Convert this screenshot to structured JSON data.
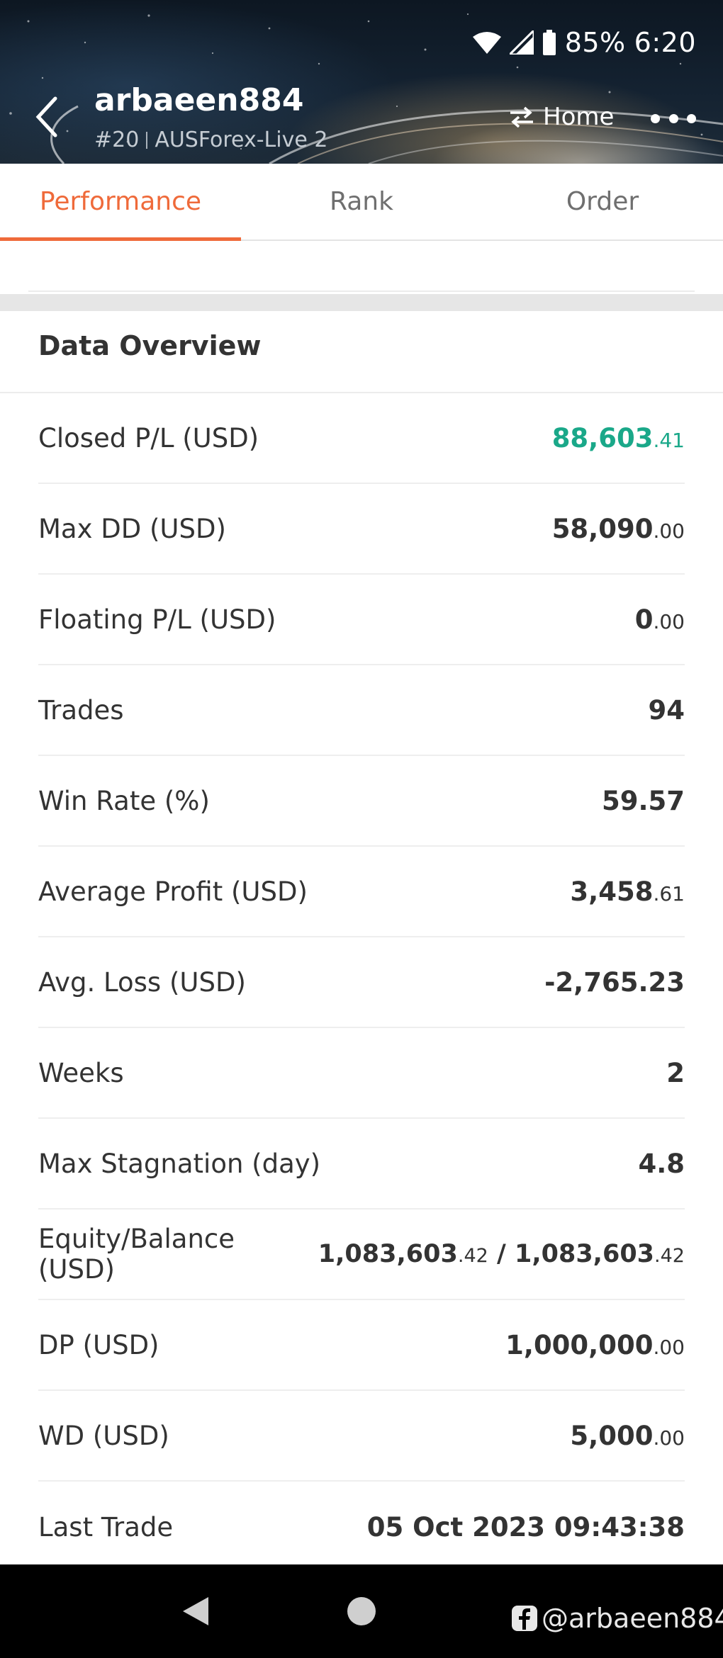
{
  "status": {
    "battery": "85%",
    "time": "6:20"
  },
  "header": {
    "account_name": "arbaeen884",
    "rank": "#20",
    "server": "AUSForex-Live 2",
    "home_label": "Home"
  },
  "tabs": [
    {
      "label": "Performance",
      "active": true
    },
    {
      "label": "Rank",
      "active": false
    },
    {
      "label": "Order",
      "active": false
    }
  ],
  "section": {
    "title": "Data Overview"
  },
  "rows": [
    {
      "label": "Closed P/L (USD)",
      "int": "88,603",
      "dec": ".41",
      "color": "#1aa889"
    },
    {
      "label": "Max DD (USD)",
      "int": "58,090",
      "dec": ".00"
    },
    {
      "label": "Floating P/L (USD)",
      "int": "0",
      "dec": ".00"
    },
    {
      "label": "Trades",
      "int": "94",
      "dec": ""
    },
    {
      "label": "Win Rate (%)",
      "int": "59.57",
      "dec": ""
    },
    {
      "label": "Average Profit (USD)",
      "int": "3,458",
      "dec": ".61"
    },
    {
      "label": "Avg. Loss (USD)",
      "int": "-2,765.23",
      "dec": ""
    },
    {
      "label": "Weeks",
      "int": "2",
      "dec": ""
    },
    {
      "label": "Max Stagnation (day)",
      "int": "4.8",
      "dec": ""
    },
    {
      "label": "Equity/Balance (USD)",
      "int": "1,083,603",
      "dec": ".42",
      "sep": " / ",
      "int2": "1,083,603",
      "dec2": ".42"
    },
    {
      "label": "DP (USD)",
      "int": "1,000,000",
      "dec": ".00"
    },
    {
      "label": "WD (USD)",
      "int": "5,000",
      "dec": ".00"
    },
    {
      "label": "Last Trade",
      "int": "05 Oct 2023 09:43:38",
      "dec": ""
    }
  ],
  "watermark": {
    "text": "@arbaeen884",
    "icon": "facebook-icon"
  }
}
